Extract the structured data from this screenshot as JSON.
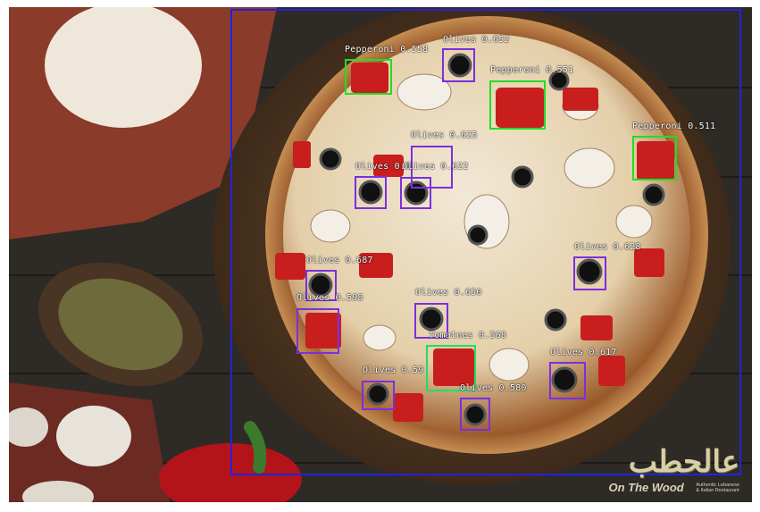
{
  "image": {
    "description_colors": {
      "boxOlive": "#7b2fe0",
      "boxPepperoni": "#22dd22",
      "boxTomato": "#22dd66",
      "pizzaFrame": "#2222dd"
    }
  },
  "detections": {
    "pep1": "Pepperoni 0.558",
    "olv1": "Olives 0.652",
    "pep2": "Pepperoni 0.551",
    "olv2": "Olives 0.625",
    "pep3": "Pepperoni 0.511",
    "olv3": "Olives 0.6",
    "olv4": "Olives 0.622",
    "olv5": "Olives 0.628",
    "olv6": "Olives 0.687",
    "olv7": "Olives 0.598",
    "olv8": "Olives 0.650",
    "tom1": "Tomatoes 0.568",
    "olv9": "Olives 0.617",
    "olv10": "Olives 0.59",
    "olv11": "Olives 0.580"
  },
  "brand": {
    "logo_text": "عالحطب",
    "name": "On The Wood",
    "tagline_1": "Authentic Lebanese",
    "tagline_2": "& Italian Restaurant"
  }
}
